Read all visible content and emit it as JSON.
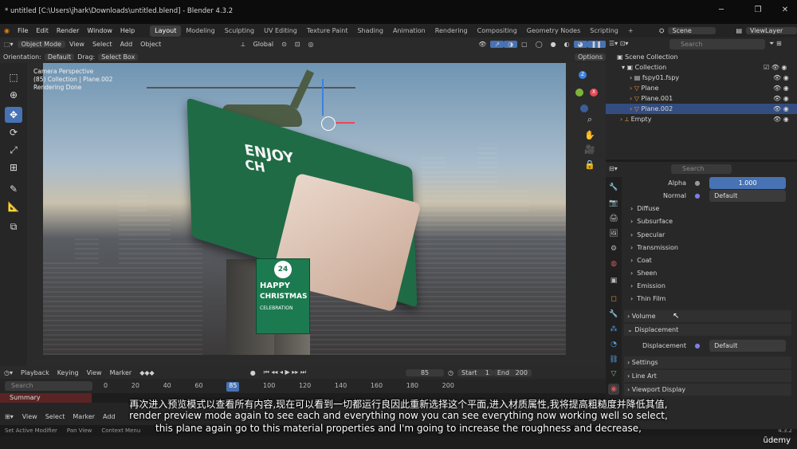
{
  "window": {
    "title": "* untitled [C:\\Users\\jhark\\Downloads\\untitled.blend] - Blender 4.3.2"
  },
  "menu": [
    "File",
    "Edit",
    "Render",
    "Window",
    "Help"
  ],
  "workspaces": [
    "Layout",
    "Modeling",
    "Sculpting",
    "UV Editing",
    "Texture Paint",
    "Shading",
    "Animation",
    "Rendering",
    "Compositing",
    "Geometry Nodes",
    "Scripting"
  ],
  "add_workspace": "+",
  "scene": {
    "label": "Scene",
    "viewlayer": "ViewLayer"
  },
  "viewport_header": {
    "mode": "Object Mode",
    "items": [
      "View",
      "Select",
      "Add",
      "Object"
    ],
    "transform": "Global"
  },
  "toolsettings": {
    "orientation_label": "Orientation:",
    "orientation": "Default",
    "drag_label": "Drag:",
    "drag": "Select Box",
    "options": "Options"
  },
  "viewport_info": {
    "line1": "Camera Perspective",
    "line2": "(85) Collection | Plane.002",
    "line3": "Rendering Done"
  },
  "outliner": {
    "search_placeholder": "Search",
    "rows": [
      "Scene Collection",
      "Collection",
      "fspy01.fspy",
      "Plane",
      "Plane.001",
      "Plane.002",
      "Empty"
    ]
  },
  "properties": {
    "search_placeholder": "Search",
    "alpha_label": "Alpha",
    "alpha_value": "1.000",
    "normal_label": "Normal",
    "normal_value": "Default",
    "sections": [
      "Diffuse",
      "Subsurface",
      "Specular",
      "Transmission",
      "Coat",
      "Sheen",
      "Emission",
      "Thin Film"
    ],
    "volume": "Volume",
    "displacement_header": "Displacement",
    "displacement_label": "Displacement",
    "displacement_value": "Default",
    "settings": "Settings",
    "line_art": "Line Art",
    "viewport_display": "Viewport Display"
  },
  "timeline": {
    "items": [
      "Playback",
      "Keying",
      "View",
      "Marker"
    ],
    "current_frame": "85",
    "start_label": "Start",
    "start": "1",
    "end_label": "End",
    "end": "200",
    "ticks": [
      "0",
      "20",
      "40",
      "60",
      "85",
      "100",
      "120",
      "140",
      "160",
      "180",
      "200"
    ]
  },
  "dopesheet": {
    "search_placeholder": "Search",
    "summary": "Summary",
    "items": [
      "View",
      "Select",
      "Marker",
      "Add"
    ]
  },
  "status": [
    "Set Active Modifier",
    "Pan View",
    "Context Menu"
  ],
  "version": "4.3.2",
  "subtitles": {
    "zh": "再次进入预览模式以查看所有内容,现在可以看到一切都运行良因此重新选择这个平面,进入材质属性,我将提高粗糙度并降低其值,",
    "en1": "render preview mode again to see each and everything now you can see everything now working well so select,",
    "en2": "this plane again go to this material properties and I'm going to increase the roughness and decrease,"
  },
  "watermark": "ūdemy",
  "banner": {
    "line1": "ENJOY",
    "line2": "CH",
    "billboard1": "24",
    "billboard2": "HAPPY",
    "billboard3": "CHRISTMAS",
    "billboard4": "CELEBRATION"
  },
  "colors": {
    "accent": "#4772b3",
    "selection": "#334d80"
  }
}
